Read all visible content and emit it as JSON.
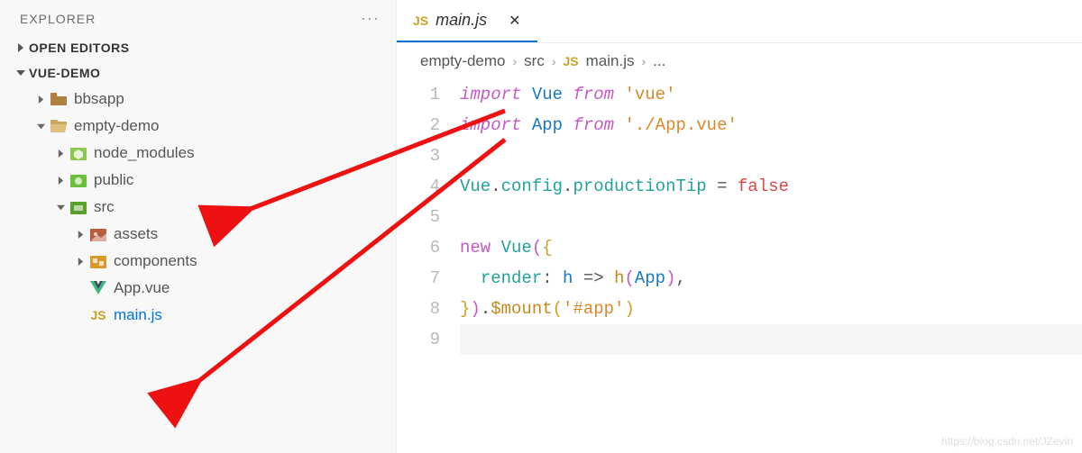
{
  "sidebar": {
    "title": "EXPLORER",
    "sections": {
      "openEditors": "OPEN EDITORS",
      "project": "VUE-DEMO"
    },
    "tree": {
      "bbsapp": "bbsapp",
      "emptyDemo": "empty-demo",
      "nodeModules": "node_modules",
      "public": "public",
      "src": "src",
      "assets": "assets",
      "components": "components",
      "appVue": "App.vue",
      "mainJs": "main.js"
    }
  },
  "tabs": {
    "main": {
      "label": "main.js",
      "icon": "JS"
    }
  },
  "breadcrumb": {
    "seg1": "empty-demo",
    "seg2": "src",
    "seg3": "main.js",
    "seg4": "...",
    "jsIcon": "JS"
  },
  "code": {
    "lines": [
      "1",
      "2",
      "3",
      "4",
      "5",
      "6",
      "7",
      "8",
      "9"
    ],
    "l1": {
      "import": "import",
      "vue": "Vue",
      "from": "from",
      "str": "'vue'"
    },
    "l2": {
      "import": "import",
      "app": "App",
      "from": "from",
      "str": "'./App.vue'"
    },
    "l4": {
      "vue": "Vue",
      "dot1": ".",
      "config": "config",
      "dot2": ".",
      "prodTip": "productionTip",
      "eq": " = ",
      "false": "false"
    },
    "l6": {
      "new": "new",
      "vue": "Vue",
      "lp": "(",
      "lb": "{"
    },
    "l7": {
      "render": "render",
      "colon": ": ",
      "arg": "h",
      "arrow": " => ",
      "fn": "h",
      "lp": "(",
      "app": "App",
      "rp": ")",
      "comma": ","
    },
    "l8": {
      "rb": "}",
      "rp": ")",
      "dot": ".",
      "mount": "$mount",
      "lp2": "(",
      "str": "'#app'",
      "rp2": ")"
    }
  },
  "watermark": "https://blog.csdn.net/JZevin"
}
